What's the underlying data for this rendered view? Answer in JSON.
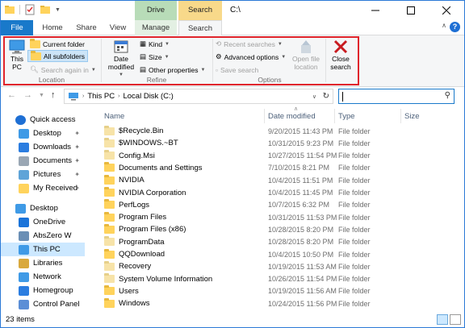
{
  "titlebar": {
    "title": "C:\\",
    "context_tabs": [
      "Drive Tools",
      "Search Tools"
    ],
    "buttons": [
      "minimize",
      "maximize",
      "close"
    ]
  },
  "tabs": [
    "File",
    "Home",
    "Share",
    "View",
    "Manage",
    "Search"
  ],
  "ribbon": {
    "location": {
      "this_pc": "This PC",
      "current_folder": "Current folder",
      "all_subfolders": "All subfolders",
      "search_again": "Search again in",
      "label": "Location"
    },
    "refine": {
      "date_modified": "Date modified",
      "kind": "Kind",
      "size": "Size",
      "other_properties": "Other properties",
      "label": "Refine"
    },
    "options": {
      "recent_searches": "Recent searches",
      "advanced_options": "Advanced options",
      "save_search": "Save search",
      "open_file_location": "Open file location",
      "label": "Options"
    },
    "close_search": "Close search"
  },
  "address": {
    "path": [
      "This PC",
      "Local Disk (C:)"
    ],
    "search_value": ""
  },
  "nav": {
    "items": [
      {
        "label": "Quick access",
        "icon": "star-icon"
      },
      {
        "label": "Desktop",
        "icon": "desktop-icon",
        "pinned": true
      },
      {
        "label": "Downloads",
        "icon": "download-icon",
        "pinned": true
      },
      {
        "label": "Documents",
        "icon": "documents-icon",
        "pinned": true
      },
      {
        "label": "Pictures",
        "icon": "pictures-icon",
        "pinned": true
      },
      {
        "label": "My Received",
        "icon": "folder-icon",
        "pinned": true
      },
      {
        "label": "Desktop",
        "icon": "desktop-icon"
      },
      {
        "label": "OneDrive",
        "icon": "cloud-icon"
      },
      {
        "label": "AbsZero W",
        "icon": "user-icon"
      },
      {
        "label": "This PC",
        "icon": "computer-icon"
      },
      {
        "label": "Libraries",
        "icon": "library-icon"
      },
      {
        "label": "Network",
        "icon": "network-icon"
      },
      {
        "label": "Homegroup",
        "icon": "homegroup-icon"
      },
      {
        "label": "Control Panel",
        "icon": "control-panel-icon"
      }
    ]
  },
  "columns": [
    "Name",
    "Date modified",
    "Type",
    "Size"
  ],
  "files": [
    {
      "name": "$Recycle.Bin",
      "date": "9/20/2015 11:43 PM",
      "type": "File folder",
      "hidden": true
    },
    {
      "name": "$WINDOWS.~BT",
      "date": "10/31/2015 9:23 PM",
      "type": "File folder",
      "hidden": true
    },
    {
      "name": "Config.Msi",
      "date": "10/27/2015 11:54 PM",
      "type": "File folder",
      "hidden": true
    },
    {
      "name": "Documents and Settings",
      "date": "7/10/2015 8:21 PM",
      "type": "File folder",
      "shortcut": true
    },
    {
      "name": "NVIDIA",
      "date": "10/4/2015 11:51 PM",
      "type": "File folder"
    },
    {
      "name": "NVIDIA Corporation",
      "date": "10/4/2015 11:45 PM",
      "type": "File folder"
    },
    {
      "name": "PerfLogs",
      "date": "10/7/2015 6:32 PM",
      "type": "File folder"
    },
    {
      "name": "Program Files",
      "date": "10/31/2015 11:53 PM",
      "type": "File folder"
    },
    {
      "name": "Program Files (x86)",
      "date": "10/28/2015 8:20 PM",
      "type": "File folder"
    },
    {
      "name": "ProgramData",
      "date": "10/28/2015 8:20 PM",
      "type": "File folder",
      "hidden": true
    },
    {
      "name": "QQDownload",
      "date": "10/4/2015 10:50 PM",
      "type": "File folder"
    },
    {
      "name": "Recovery",
      "date": "10/19/2015 11:53 AM",
      "type": "File folder",
      "hidden": true
    },
    {
      "name": "System Volume Information",
      "date": "10/26/2015 11:54 PM",
      "type": "File folder",
      "hidden": true
    },
    {
      "name": "Users",
      "date": "10/19/2015 11:56 AM",
      "type": "File folder"
    },
    {
      "name": "Windows",
      "date": "10/24/2015 11:56 PM",
      "type": "File folder"
    }
  ],
  "status": {
    "item_count": "23 items"
  },
  "colors": {
    "accent": "#1979ca",
    "highlight_frame": "#e0252c",
    "drive_tools": "#b8dcb8",
    "search_tools": "#f8d98a",
    "selection": "#cce8ff"
  }
}
